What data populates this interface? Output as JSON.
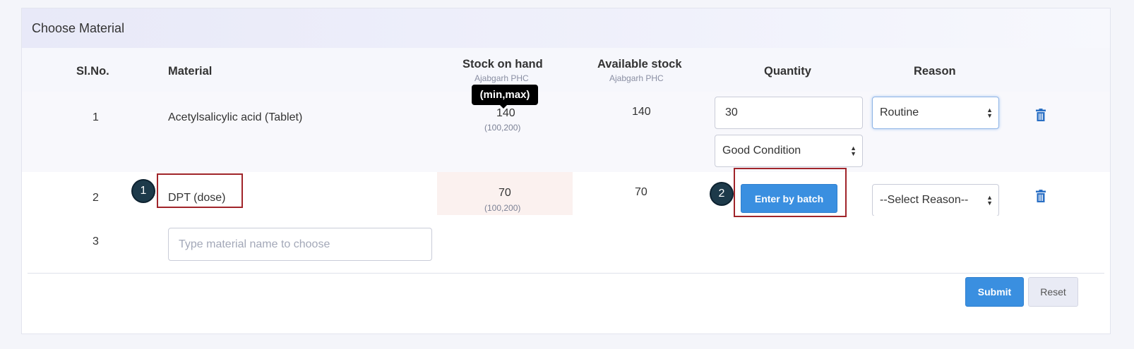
{
  "panel": {
    "title": "Choose Material"
  },
  "columns": {
    "slno": "Sl.No.",
    "material": "Material",
    "stock_on_hand": "Stock on hand",
    "stock_on_hand_sub": "Ajabgarh PHC",
    "available_stock": "Available stock",
    "available_stock_sub": "Ajabgarh PHC",
    "quantity": "Quantity",
    "reason": "Reason"
  },
  "tooltip": {
    "text": "(min,max)"
  },
  "rows": [
    {
      "slno": "1",
      "material": "Acetylsalicylic acid (Tablet)",
      "stock_on_hand": "140",
      "minmax": "(100,200)",
      "available_stock": "140",
      "quantity": "30",
      "condition": "Good Condition",
      "reason": "Routine"
    },
    {
      "slno": "2",
      "material": "DPT (dose)",
      "stock_on_hand": "70",
      "minmax": "(100,200)",
      "available_stock": "70",
      "batch_button": "Enter by batch",
      "reason": "--Select Reason--"
    },
    {
      "slno": "3",
      "material_placeholder": "Type material name to choose"
    }
  ],
  "actions": {
    "submit": "Submit",
    "reset": "Reset"
  },
  "callouts": {
    "one": "1",
    "two": "2"
  },
  "colors": {
    "primary": "#3a8fe0",
    "callout_border": "#a0242a",
    "badge": "#1d3a4a"
  }
}
